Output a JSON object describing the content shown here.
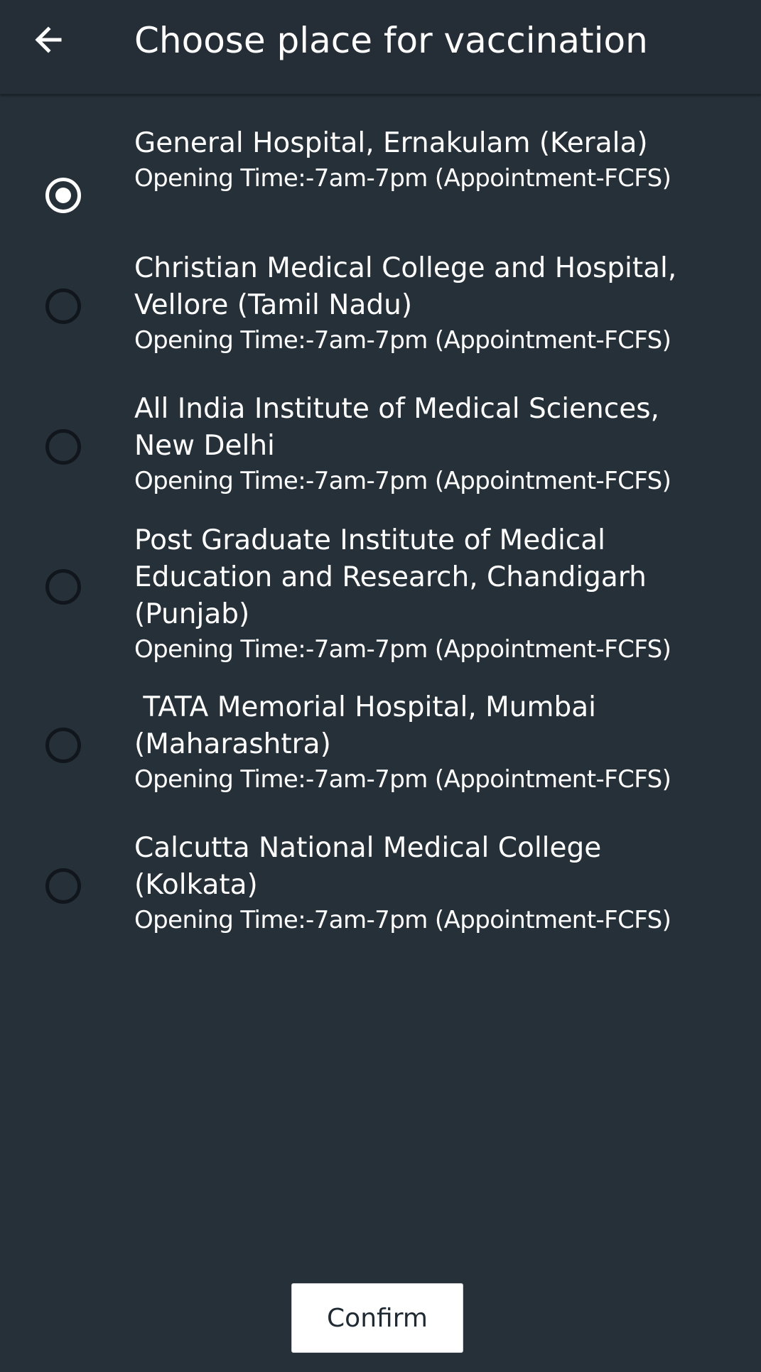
{
  "header": {
    "back_icon": "arrow-left-icon",
    "title": "Choose place for vaccination"
  },
  "options": [
    {
      "name": "General Hospital, Ernakulam (Kerala)",
      "hours": "Opening Time:-7am-7pm (Appointment-FCFS)",
      "selected": true
    },
    {
      "name": "Christian Medical College and Hospital,\nVellore (Tamil Nadu)",
      "hours": "Opening Time:-7am-7pm (Appointment-FCFS)",
      "selected": false
    },
    {
      "name": "All India Institute of Medical Sciences,\nNew Delhi",
      "hours": "Opening Time:-7am-7pm (Appointment-FCFS)",
      "selected": false
    },
    {
      "name": "Post Graduate Institute of Medical\nEducation and Research, Chandigarh\n(Punjab)",
      "hours": "Opening Time:-7am-7pm (Appointment-FCFS)",
      "selected": false
    },
    {
      "name": " TATA Memorial Hospital, Mumbai\n(Maharashtra)",
      "hours": "Opening Time:-7am-7pm (Appointment-FCFS)",
      "selected": false
    },
    {
      "name": "Calcutta National Medical College\n(Kolkata)",
      "hours": "Opening Time:-7am-7pm (Appointment-FCFS)",
      "selected": false
    }
  ],
  "confirm_label": "Confirm",
  "colors": {
    "background": "#263039",
    "text": "#ffffff",
    "radio_unchecked": "#10161b",
    "button_bg": "#ffffff",
    "button_text": "#1f2a33"
  }
}
